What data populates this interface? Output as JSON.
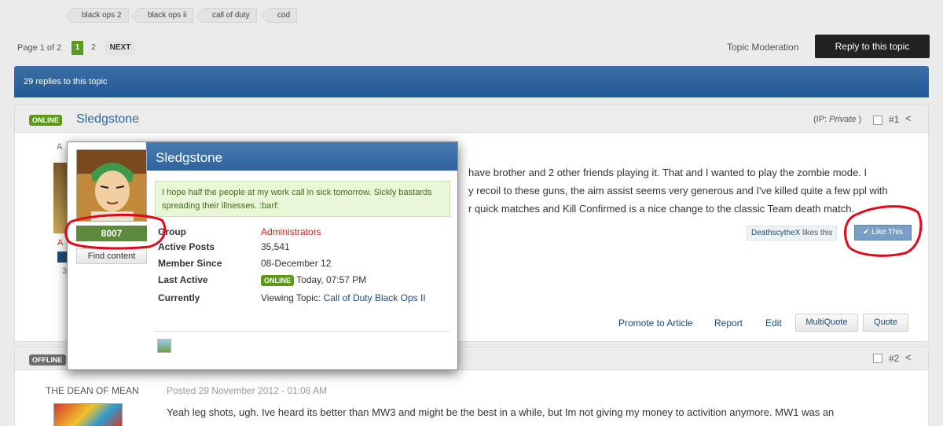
{
  "tags": [
    "black ops 2",
    "black ops ii",
    "call of duty",
    "cod"
  ],
  "pagination": {
    "summary": "Page 1 of 2",
    "current": "1",
    "other": "2",
    "next": "NEXT"
  },
  "topic_moderation": "Topic Moderation",
  "reply_button": "Reply to this topic",
  "replies_header": "29 replies to this topic",
  "post1": {
    "status": "ONLINE",
    "author": "Sledgstone",
    "ip_label": "(IP: ",
    "ip_value": "Private",
    "ip_close": " )",
    "number": "#1",
    "body_lines": [
      "have brother and 2 other friends playing it. That and I wanted to play the zombie mode. I",
      "y recoil to these guns, the aim assist seems very generous and I've killed quite a few ppl with",
      "r quick matches and Kill Confirmed is a nice change to the classic Team death match."
    ],
    "likes_user": "DeathscytheX",
    "likes_text": " likes this",
    "like_button": "Like This",
    "actions": [
      "Promote to Article",
      "Report",
      "Edit",
      "MultiQuote",
      "Quote"
    ]
  },
  "hovercard": {
    "name": "Sledgstone",
    "status_message": "I hope half the people at my work call in sick tomorrow. Sickly bastards spreading their illnesses. :barf:",
    "reputation": "8007",
    "find_content": "Find content",
    "fields": [
      {
        "label": "Group",
        "value": "Administrators"
      },
      {
        "label": "Active Posts",
        "value": "35,541"
      },
      {
        "label": "Member Since",
        "value": "08-December 12"
      },
      {
        "label": "Last Active",
        "value": "Today, 07:57 PM",
        "badge": "ONLINE"
      },
      {
        "label": "Currently",
        "prefix": "Viewing Topic: ",
        "value": "Call of Duty Black Ops II"
      }
    ],
    "colors": {
      "group": "#d8201c",
      "rep": "#5c8a3a",
      "highlight": "#e0081a"
    }
  },
  "post2": {
    "status": "OFFLINE",
    "number": "#2",
    "author": "THE DEAN OF MEAN",
    "posted": "Posted 29 November 2012 - 01:08 AM",
    "body": "Yeah leg shots, ugh. Ive heard its better than MW3 and might be the best in a while, but Im not giving my money to activition anymore. MW1 was an"
  }
}
